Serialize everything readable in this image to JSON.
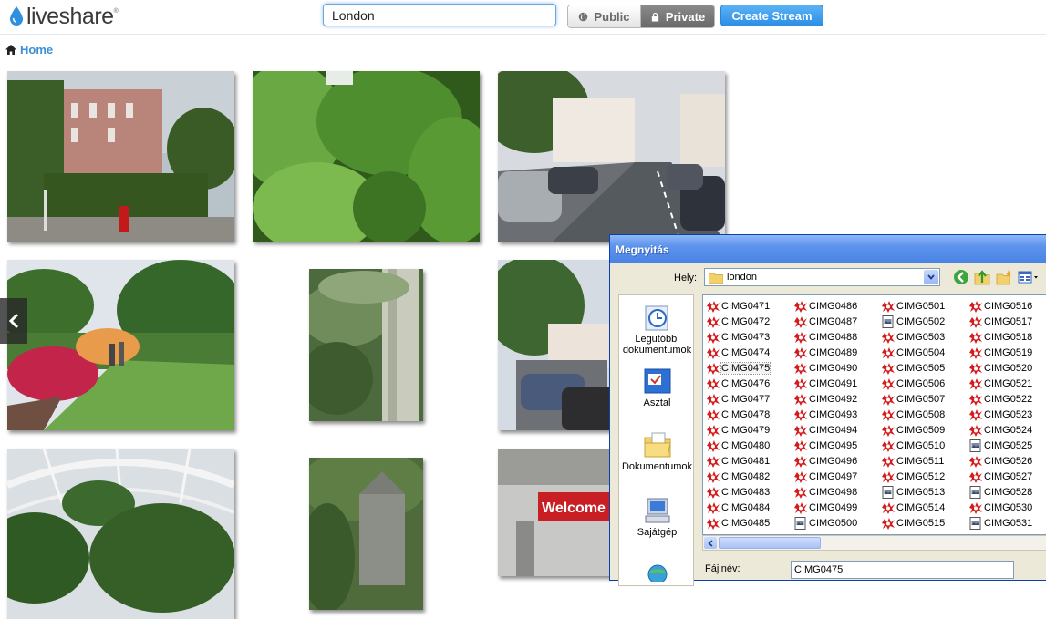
{
  "header": {
    "logo_text": "liveshare",
    "logo_tm": "®",
    "search_value": "London",
    "public_label": "Public",
    "private_label": "Private",
    "create_label": "Create Stream",
    "accent_color": "#3d8fd6"
  },
  "breadcrumb": {
    "home_label": "Home"
  },
  "photos": [
    {
      "name": "photo-street-hedge",
      "subject": "red-brick houses behind a tall green hedge, red post box"
    },
    {
      "name": "photo-green-trees",
      "subject": "dense green tree foliage"
    },
    {
      "name": "photo-parked-cars-street",
      "subject": "residential street lined with parked cars"
    },
    {
      "name": "photo-park-flowers",
      "subject": "park lawn with red and orange flowering shrubs"
    },
    {
      "name": "photo-tree-fern",
      "subject": "tree ferns and a pale tree trunk"
    },
    {
      "name": "photo-street-partial",
      "subject": "street with parked cars and trees"
    },
    {
      "name": "photo-glasshouse",
      "subject": "palm glasshouse interior"
    },
    {
      "name": "photo-church-trees",
      "subject": "church behind trees"
    },
    {
      "name": "photo-welcome-sign",
      "subject": "red welcome sign in a hall"
    }
  ],
  "dialog": {
    "title": "Megnyitás",
    "location_label": "Hely:",
    "location_value": "london",
    "places": [
      {
        "name": "recent",
        "label": "Legutóbbi dokumentumok",
        "icon": "recent-documents-icon"
      },
      {
        "name": "desktop",
        "label": "Asztal",
        "icon": "desktop-icon"
      },
      {
        "name": "documents",
        "label": "Dokumentumok",
        "icon": "documents-folder-icon"
      },
      {
        "name": "computer",
        "label": "Sajátgép",
        "icon": "my-computer-icon"
      }
    ],
    "files": [
      {
        "name": "CIMG0471",
        "type": "raw"
      },
      {
        "name": "CIMG0486",
        "type": "raw"
      },
      {
        "name": "CIMG0501",
        "type": "raw"
      },
      {
        "name": "CIMG0516",
        "type": "raw"
      },
      {
        "name": "CIMG0472",
        "type": "raw"
      },
      {
        "name": "CIMG0487",
        "type": "raw"
      },
      {
        "name": "CIMG0502",
        "type": "jpg"
      },
      {
        "name": "CIMG0517",
        "type": "raw"
      },
      {
        "name": "CIMG0473",
        "type": "raw"
      },
      {
        "name": "CIMG0488",
        "type": "raw"
      },
      {
        "name": "CIMG0503",
        "type": "raw"
      },
      {
        "name": "CIMG0518",
        "type": "raw"
      },
      {
        "name": "CIMG0474",
        "type": "raw"
      },
      {
        "name": "CIMG0489",
        "type": "raw"
      },
      {
        "name": "CIMG0504",
        "type": "raw"
      },
      {
        "name": "CIMG0519",
        "type": "raw"
      },
      {
        "name": "CIMG0475",
        "type": "raw",
        "selected": true
      },
      {
        "name": "CIMG0490",
        "type": "raw"
      },
      {
        "name": "CIMG0505",
        "type": "raw"
      },
      {
        "name": "CIMG0520",
        "type": "raw"
      },
      {
        "name": "CIMG0476",
        "type": "raw"
      },
      {
        "name": "CIMG0491",
        "type": "raw"
      },
      {
        "name": "CIMG0506",
        "type": "raw"
      },
      {
        "name": "CIMG0521",
        "type": "raw"
      },
      {
        "name": "CIMG0477",
        "type": "raw"
      },
      {
        "name": "CIMG0492",
        "type": "raw"
      },
      {
        "name": "CIMG0507",
        "type": "raw"
      },
      {
        "name": "CIMG0522",
        "type": "raw"
      },
      {
        "name": "CIMG0478",
        "type": "raw"
      },
      {
        "name": "CIMG0493",
        "type": "raw"
      },
      {
        "name": "CIMG0508",
        "type": "raw"
      },
      {
        "name": "CIMG0523",
        "type": "raw"
      },
      {
        "name": "CIMG0479",
        "type": "raw"
      },
      {
        "name": "CIMG0494",
        "type": "raw"
      },
      {
        "name": "CIMG0509",
        "type": "raw"
      },
      {
        "name": "CIMG0524",
        "type": "raw"
      },
      {
        "name": "CIMG0480",
        "type": "raw"
      },
      {
        "name": "CIMG0495",
        "type": "raw"
      },
      {
        "name": "CIMG0510",
        "type": "raw"
      },
      {
        "name": "CIMG0525",
        "type": "jpg"
      },
      {
        "name": "CIMG0481",
        "type": "raw"
      },
      {
        "name": "CIMG0496",
        "type": "raw"
      },
      {
        "name": "CIMG0511",
        "type": "raw"
      },
      {
        "name": "CIMG0526",
        "type": "raw"
      },
      {
        "name": "CIMG0482",
        "type": "raw"
      },
      {
        "name": "CIMG0497",
        "type": "raw"
      },
      {
        "name": "CIMG0512",
        "type": "raw"
      },
      {
        "name": "CIMG0527",
        "type": "raw"
      },
      {
        "name": "CIMG0483",
        "type": "raw"
      },
      {
        "name": "CIMG0498",
        "type": "raw"
      },
      {
        "name": "CIMG0513",
        "type": "jpg"
      },
      {
        "name": "CIMG0528",
        "type": "jpg"
      },
      {
        "name": "CIMG0484",
        "type": "raw"
      },
      {
        "name": "CIMG0499",
        "type": "raw"
      },
      {
        "name": "CIMG0514",
        "type": "raw"
      },
      {
        "name": "CIMG0530",
        "type": "raw"
      },
      {
        "name": "CIMG0485",
        "type": "raw"
      },
      {
        "name": "CIMG0500",
        "type": "jpg"
      },
      {
        "name": "CIMG0515",
        "type": "raw"
      },
      {
        "name": "CIMG0531",
        "type": "jpg"
      }
    ],
    "filename_label": "Fájlnév:",
    "filename_value": "CIMG0475"
  }
}
